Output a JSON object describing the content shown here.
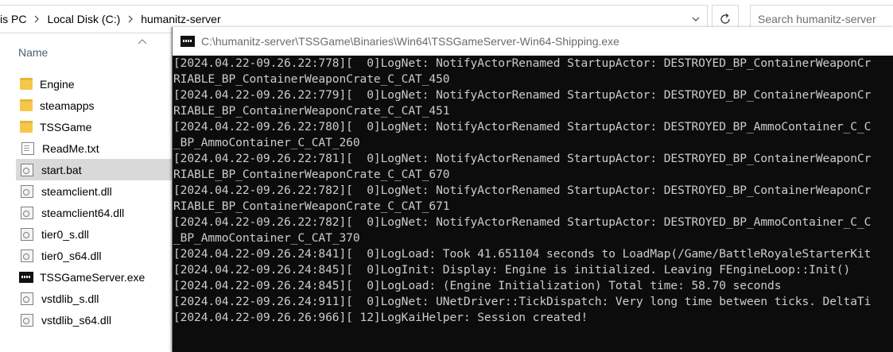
{
  "explorer": {
    "breadcrumbs": [
      "is PC",
      "Local Disk (C:)",
      "humanitz-server"
    ],
    "search_placeholder": "Search humanitz-server",
    "column_header": "Name",
    "files": [
      {
        "name": "Engine",
        "icon": "folder-icon",
        "selected": false
      },
      {
        "name": "steamapps",
        "icon": "folder-icon",
        "selected": false
      },
      {
        "name": "TSSGame",
        "icon": "folder-icon",
        "selected": false
      },
      {
        "name": "ReadMe.txt",
        "icon": "text-file-icon",
        "selected": false
      },
      {
        "name": "start.bat",
        "icon": "batch-file-icon",
        "selected": true
      },
      {
        "name": "steamclient.dll",
        "icon": "dll-file-icon",
        "selected": false
      },
      {
        "name": "steamclient64.dll",
        "icon": "dll-file-icon",
        "selected": false
      },
      {
        "name": "tier0_s.dll",
        "icon": "dll-file-icon",
        "selected": false
      },
      {
        "name": "tier0_s64.dll",
        "icon": "dll-file-icon",
        "selected": false
      },
      {
        "name": "TSSGameServer.exe",
        "icon": "exe-file-icon",
        "selected": false
      },
      {
        "name": "vstdlib_s.dll",
        "icon": "dll-file-icon",
        "selected": false
      },
      {
        "name": "vstdlib_s64.dll",
        "icon": "dll-file-icon",
        "selected": false
      }
    ]
  },
  "console": {
    "title": "C:\\humanitz-server\\TSSGame\\Binaries\\Win64\\TSSGameServer-Win64-Shipping.exe",
    "lines": [
      "[2024.04.22-09.26.22:778][  0]LogNet: NotifyActorRenamed StartupActor: DESTROYED_BP_ContainerWeaponCr",
      "RIABLE_BP_ContainerWeaponCrate_C_CAT_450",
      "[2024.04.22-09.26.22:779][  0]LogNet: NotifyActorRenamed StartupActor: DESTROYED_BP_ContainerWeaponCr",
      "RIABLE_BP_ContainerWeaponCrate_C_CAT_451",
      "[2024.04.22-09.26.22:780][  0]LogNet: NotifyActorRenamed StartupActor: DESTROYED_BP_AmmoContainer_C_C",
      "_BP_AmmoContainer_C_CAT_260",
      "[2024.04.22-09.26.22:781][  0]LogNet: NotifyActorRenamed StartupActor: DESTROYED_BP_ContainerWeaponCr",
      "RIABLE_BP_ContainerWeaponCrate_C_CAT_670",
      "[2024.04.22-09.26.22:782][  0]LogNet: NotifyActorRenamed StartupActor: DESTROYED_BP_ContainerWeaponCr",
      "RIABLE_BP_ContainerWeaponCrate_C_CAT_671",
      "[2024.04.22-09.26.22:782][  0]LogNet: NotifyActorRenamed StartupActor: DESTROYED_BP_AmmoContainer_C_C",
      "_BP_AmmoContainer_C_CAT_370",
      "[2024.04.22-09.26.24:841][  0]LogLoad: Took 41.651104 seconds to LoadMap(/Game/BattleRoyaleStarterKit",
      "[2024.04.22-09.26.24:845][  0]LogInit: Display: Engine is initialized. Leaving FEngineLoop::Init()",
      "[2024.04.22-09.26.24:845][  0]LogLoad: (Engine Initialization) Total time: 58.70 seconds",
      "[2024.04.22-09.26.24:911][  0]LogNet: UNetDriver::TickDispatch: Very long time between ticks. DeltaTi",
      "[2024.04.22-09.26.26:966][ 12]LogKaiHelper: Session created!"
    ]
  }
}
